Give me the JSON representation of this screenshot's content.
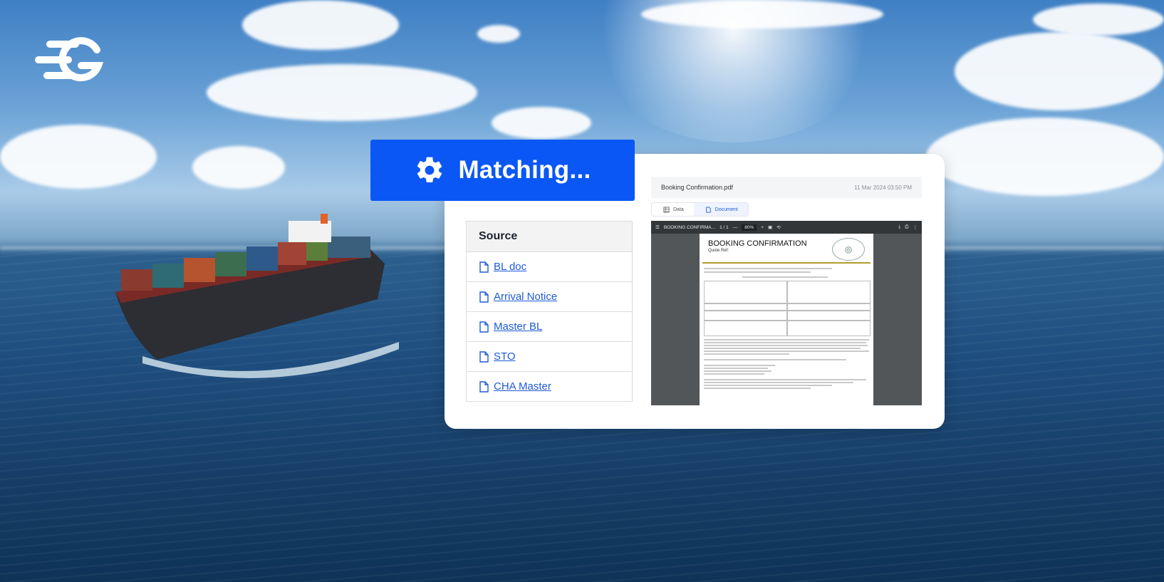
{
  "matching": {
    "label": "Matching...",
    "icon": "gear-icon",
    "color": "#0a57f5"
  },
  "source": {
    "header": "Source",
    "items": [
      {
        "label": "BL doc",
        "icon": "document-icon"
      },
      {
        "label": "Arrival Notice",
        "icon": "document-icon"
      },
      {
        "label": "Master BL",
        "icon": "document-icon"
      },
      {
        "label": "STO",
        "icon": "document-icon"
      },
      {
        "label": "CHA Master",
        "icon": "document-icon"
      }
    ],
    "link_color": "#1e5bd8"
  },
  "file": {
    "name": "Booking Confirmation.pdf",
    "date": "11 Mar 2024 03:50 PM"
  },
  "tabs": [
    {
      "label": "Data",
      "icon": "table-icon",
      "active": false
    },
    {
      "label": "Document",
      "icon": "document-icon",
      "active": true
    }
  ],
  "viewer": {
    "toolbar_title": "BOOKING CONFIRMA...",
    "page_count": "1 / 1",
    "zoom": "80%",
    "doc_title": "BOOKING CONFIRMATION",
    "doc_ref": "Quote Ref:"
  }
}
